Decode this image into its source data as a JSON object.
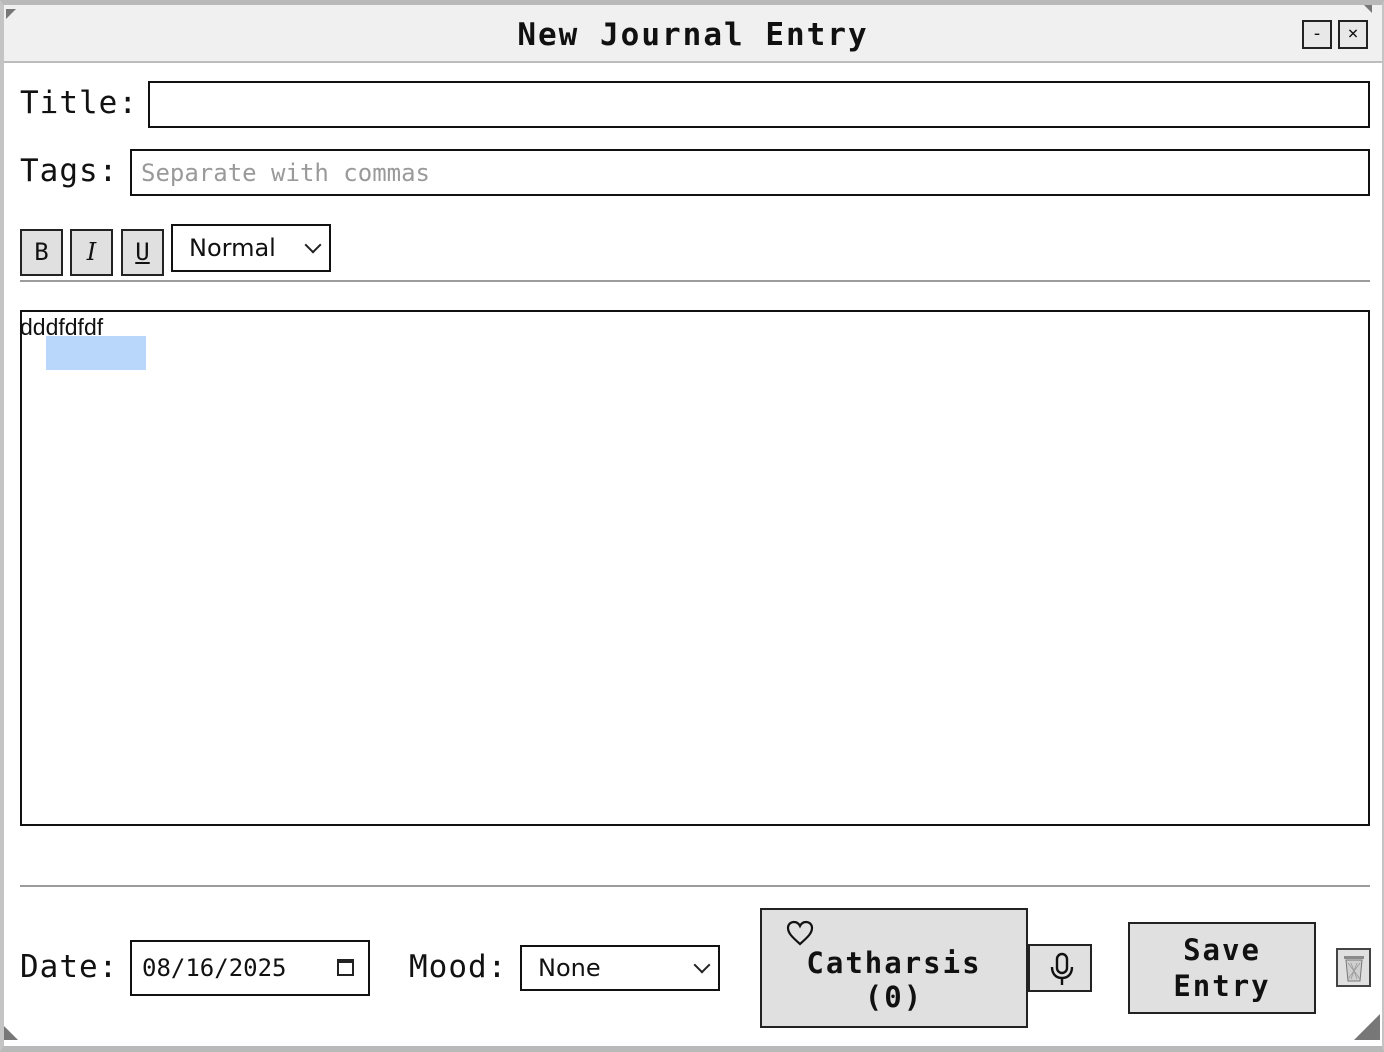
{
  "window": {
    "title": "New Journal Entry",
    "minimize_label": "-",
    "close_label": "×"
  },
  "form": {
    "title_label": "Title:",
    "title_value": "",
    "tags_label": "Tags:",
    "tags_placeholder": "Separate with commas",
    "tags_value": ""
  },
  "toolbar": {
    "bold_label": "B",
    "italic_label": "I",
    "underline_label": "U",
    "style_selected": "Normal"
  },
  "editor": {
    "content": "dddfdfdf"
  },
  "footer": {
    "date_label": "Date:",
    "date_value": "08/16/2025",
    "mood_label": "Mood:",
    "mood_selected": "None",
    "catharsis_label": "Catharsis",
    "catharsis_count": "(0)",
    "save_line1": "Save",
    "save_line2": "Entry"
  },
  "icons": {
    "heart": "heart-icon",
    "microphone": "microphone-icon",
    "trash": "trash-icon",
    "calendar": "calendar-icon",
    "chevron": "chevron-down-icon"
  },
  "colors": {
    "selection": "#b9d6fb",
    "button_bg": "#e0e0e0",
    "titlebar_bg": "#f0f0f0"
  }
}
